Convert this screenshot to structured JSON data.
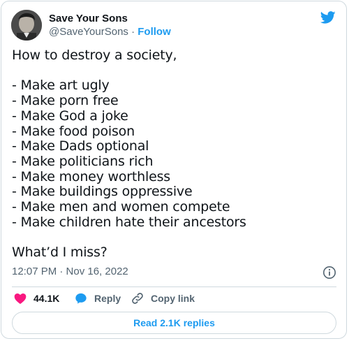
{
  "user": {
    "display_name": "Save Your Sons",
    "handle": "@SaveYourSons",
    "separator": " · ",
    "follow_label": "Follow"
  },
  "tweet": {
    "text": "How to destroy a society,\n\n- Make art ugly\n- Make porn free\n- Make God a joke\n- Make food poison\n- Make Dads optional\n- Make politicians rich\n- Make money worthless\n- Make buildings oppressive\n- Make men and women compete\n- Make children hate their ancestors\n\nWhat’d I miss?",
    "timestamp": "12:07 PM · Nov 16, 2022"
  },
  "actions": {
    "likes": "44.1K",
    "reply_label": "Reply",
    "copy_link_label": "Copy link"
  },
  "footer": {
    "read_replies_label": "Read 2.1K replies"
  },
  "colors": {
    "accent": "#1d9bf0",
    "like": "#f91880",
    "muted": "#536471",
    "border": "#cfd9de"
  },
  "icons": [
    "twitter-bird-icon",
    "info-icon",
    "heart-icon",
    "reply-icon",
    "link-icon"
  ]
}
